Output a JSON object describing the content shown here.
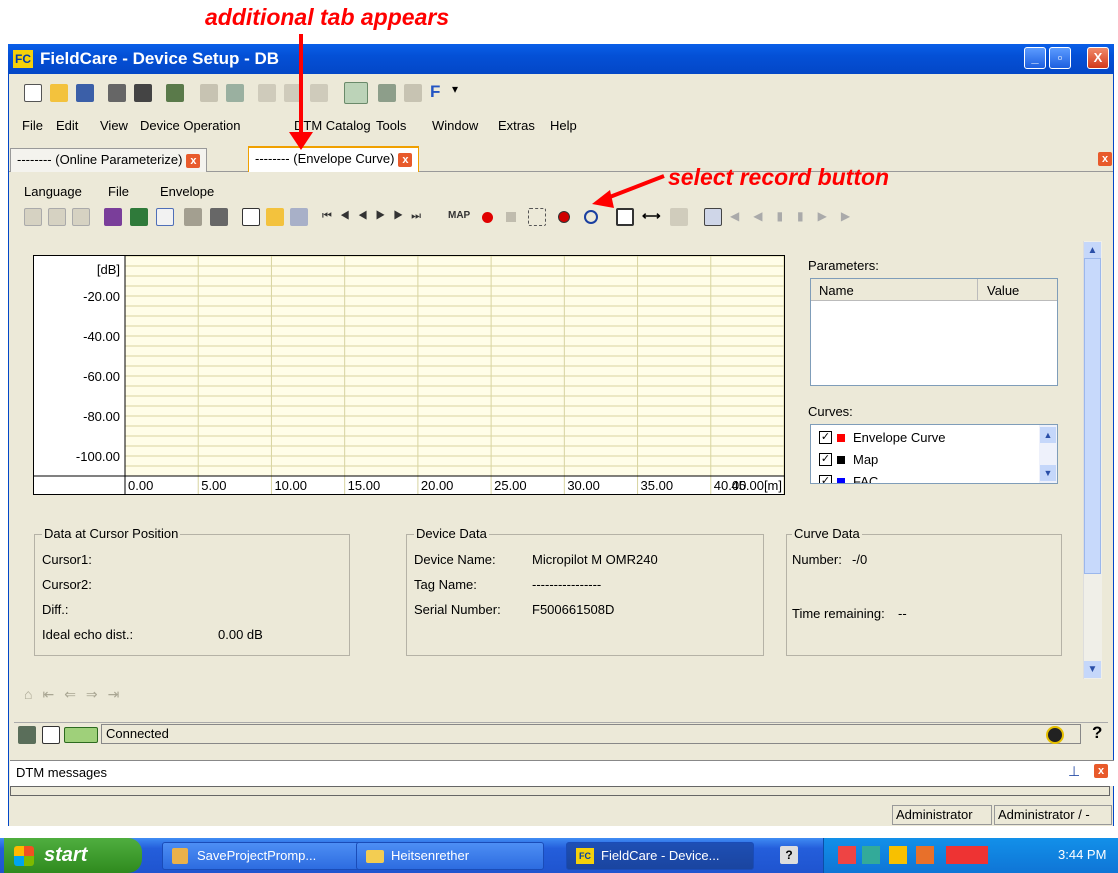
{
  "annotations": {
    "tab_note": "additional tab appears",
    "record_note": "select record button"
  },
  "window": {
    "title": "FieldCare - Device Setup - DB",
    "minimize": "_",
    "maximize": "▫",
    "close": "X"
  },
  "menubar": [
    "File",
    "Edit",
    "View",
    "Device Operation",
    "DTM Catalog",
    "Tools",
    "Window",
    "Extras",
    "Help"
  ],
  "tabs": [
    {
      "label": "-------- (Online Parameterize)"
    },
    {
      "label": "-------- (Envelope Curve)"
    }
  ],
  "submenu": [
    "Language",
    "File",
    "Envelope"
  ],
  "toolbar_text": {
    "map": "MAP"
  },
  "chart_data": {
    "type": "line",
    "ylabel": "[dB]",
    "y_ticks": [
      "-20.00",
      "-40.00",
      "-60.00",
      "-80.00",
      "-100.00"
    ],
    "x_ticks": [
      "0.00",
      "5.00",
      "10.00",
      "15.00",
      "20.00",
      "25.00",
      "30.00",
      "35.00",
      "40.00",
      "45.00[m]"
    ],
    "xlim": [
      0,
      45
    ],
    "ylim": [
      -110,
      0
    ],
    "series": []
  },
  "parameters": {
    "title": "Parameters:",
    "col_name": "Name",
    "col_value": "Value"
  },
  "curves": {
    "title": "Curves:",
    "items": [
      {
        "label": "Envelope Curve",
        "color": "#ff0000"
      },
      {
        "label": "Map",
        "color": "#000000"
      },
      {
        "label": "FAC",
        "color": "#0000ff"
      }
    ]
  },
  "cursor_data": {
    "title": "Data at Cursor Position",
    "cursor1": "Cursor1:",
    "cursor2": "Cursor2:",
    "diff": "Diff.:",
    "ideal": "Ideal echo dist.:",
    "ideal_value": "0.00 dB"
  },
  "device_data": {
    "title": "Device Data",
    "name_label": "Device Name:",
    "name_value": "Micropilot M OMR240",
    "tag_label": "Tag Name:",
    "tag_value": "----------------",
    "serial_label": "Serial Number:",
    "serial_value": "F500661508D"
  },
  "curve_data": {
    "title": "Curve Data",
    "number_label": "Number:",
    "number_value": "-/0",
    "time_label": "Time remaining:",
    "time_value": "--"
  },
  "status": {
    "connected": "Connected",
    "help": "?"
  },
  "dtm_messages": "DTM messages",
  "userbar": {
    "user1": "Administrator",
    "user2": "Administrator / -"
  },
  "taskbar": {
    "start": "start",
    "tasks": [
      "SaveProjectPromp...",
      "Heitsenrether",
      "FieldCare - Device..."
    ],
    "clock": "3:44 PM"
  },
  "colors": {
    "titlebar": "#0450d6",
    "chart_bg": "#fffde8",
    "annotation": "#ff0000"
  }
}
